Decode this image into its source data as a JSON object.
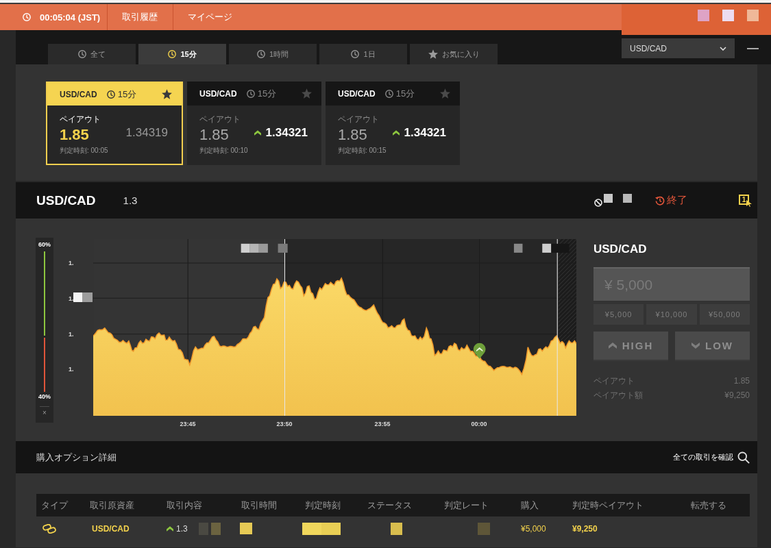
{
  "top_bar": {
    "clock": "00:05:04 (JST)",
    "links": [
      "取引履歴",
      "マイページ"
    ]
  },
  "tabs": [
    {
      "label": "全て",
      "kind": "period",
      "selected": false
    },
    {
      "label": "15分",
      "kind": "period",
      "selected": true
    },
    {
      "label": "1時間",
      "kind": "period",
      "selected": false
    },
    {
      "label": "1日",
      "kind": "period",
      "selected": false
    },
    {
      "label": "お気に入り",
      "kind": "favorites",
      "selected": false
    }
  ],
  "asset_dropdown": {
    "value": "USD/CAD"
  },
  "cards": [
    {
      "asset": "USD/CAD",
      "period": "15分",
      "selected": true,
      "payout_label": "ペイアウト",
      "payout": "1.85",
      "kind": "unchanged",
      "rate": "1.34319",
      "expiry": "判定時刻: 00:05"
    },
    {
      "asset": "USD/CAD",
      "period": "15分",
      "selected": false,
      "payout_label": "ペイアウト",
      "payout": "1.85",
      "kind": "rising",
      "rate": "1.34321",
      "expiry": "判定時刻: 00:10"
    },
    {
      "asset": "USD/CAD",
      "period": "15分",
      "selected": false,
      "payout_label": "ペイアウト",
      "payout": "1.85",
      "kind": "rising",
      "rate": "1.34321",
      "expiry": "判定時刻: 00:15"
    }
  ],
  "chart_header": {
    "asset": "USD/CAD",
    "rate": "1.3",
    "status": "終了",
    "one_click": "1"
  },
  "sentiment": {
    "high": "60%",
    "low": "40%",
    "level": 0.6,
    "close": "×"
  },
  "chart": {
    "y_labels": [
      "1.",
      "1.",
      "1.",
      "1."
    ],
    "x_labels": [
      "23:45",
      "23:50",
      "23:55",
      "00:00"
    ]
  },
  "trade_panel": {
    "asset": "USD/CAD",
    "amount": "¥ 5,000",
    "presets": [
      "¥5,000",
      "¥10,000",
      "¥50,000"
    ],
    "buttons": [
      {
        "label": "HIGH",
        "kind": "high",
        "disabled": true
      },
      {
        "label": "LOW",
        "kind": "low",
        "disabled": true
      }
    ],
    "summary": [
      {
        "label": "ペイアウト",
        "value": "1.85"
      },
      {
        "label": "ペイアウト額",
        "value": "¥9,250"
      }
    ]
  },
  "details": {
    "title": "購入オプション詳細",
    "link": "全ての取引を確認",
    "columns": [
      "タイプ",
      "取引原資産",
      "取引内容",
      "取引時間",
      "判定時刻",
      "ステータス",
      "判定レート",
      "購入",
      "判定時ペイアウト",
      "転売する"
    ],
    "rows": [
      {
        "asset": "USD/CAD",
        "kind": "rising",
        "rate": "1.3",
        "purchase": "¥5,000",
        "payout": "¥9,250"
      }
    ]
  }
}
